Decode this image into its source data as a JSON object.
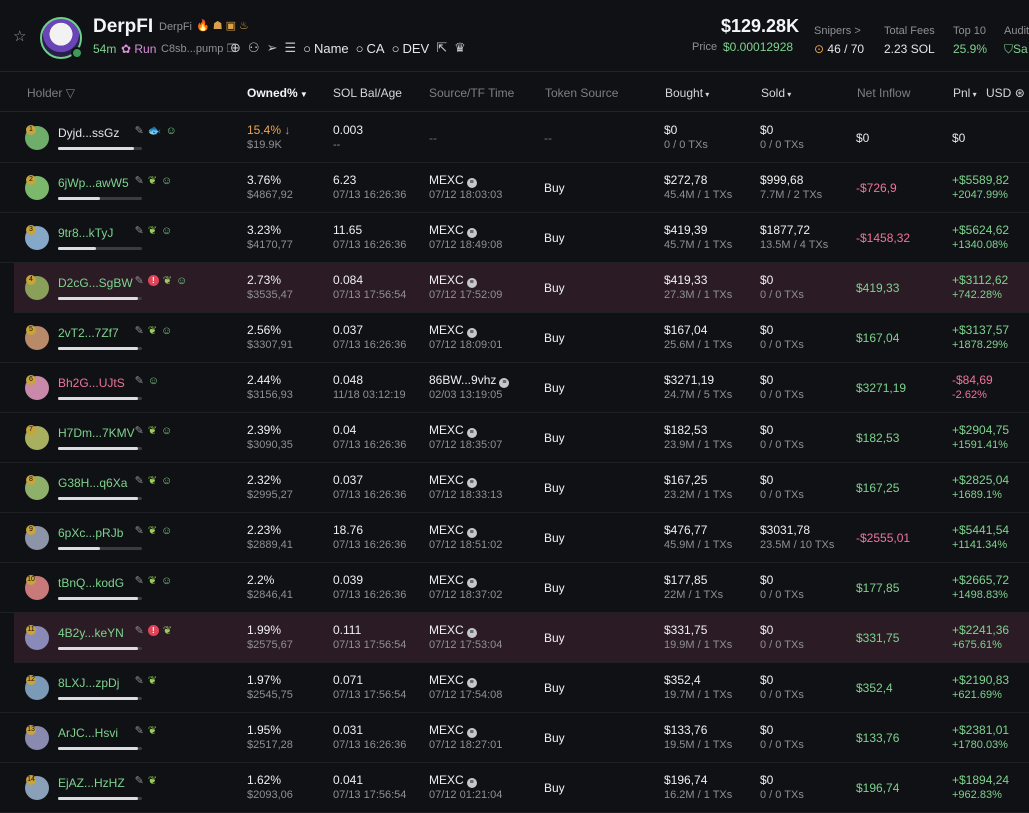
{
  "token": {
    "name": "DerpFI",
    "symbol": "DerpFi",
    "age": "54m",
    "run_label": "Run",
    "contract": "C8sb...pump",
    "tools": {
      "name_label": "Name",
      "ca_label": "CA",
      "dev_label": "DEV"
    }
  },
  "market": {
    "market_cap": "$129.28K",
    "price_label": "Price",
    "price": "$0.00012928"
  },
  "stats": [
    {
      "label": "Snipers >",
      "value": "46 / 70"
    },
    {
      "label": "Total Fees",
      "value": "2.23 SOL"
    },
    {
      "label": "Top 10",
      "value": "25.9%"
    },
    {
      "label": "Audit",
      "value": "Sa"
    }
  ],
  "columns": {
    "holder": "Holder",
    "owned": "Owned%",
    "sol_bal": "SOL Bal/Age",
    "source": "Source/TF Time",
    "token_source": "Token Source",
    "bought": "Bought",
    "sold": "Sold",
    "net_inflow": "Net Inflow",
    "pnl": "Pnl",
    "currency": "USD"
  },
  "rows": [
    {
      "rank": "1",
      "holder": "Dyjd...ssGz",
      "pct": "15.4%",
      "pct_arrow": "↓",
      "value": "$19.9K",
      "sol": "0.003",
      "age": "--",
      "src": "--",
      "tf": "",
      "tsrc": "--",
      "b1": "$0",
      "b2": "0 / 0 TXs",
      "s1": "$0",
      "s2": "0 / 0 TXs",
      "net": "$0",
      "p1": "$0",
      "p2": "",
      "bar": 0.9,
      "icons": "fish"
    },
    {
      "rank": "2",
      "holder": "6jWp...awW5",
      "pct": "3.76%",
      "value": "$4867,92",
      "sol": "6.23",
      "age": "07/13 16:26:36",
      "src": "MEXC",
      "tf": "07/12 18:03:03",
      "tsrc": "Buy",
      "b1": "$272,78",
      "b2": "45.4M / 1 TXs",
      "s1": "$999,68",
      "s2": "7.7M / 2 TXs",
      "net": "-$726,9",
      "p1": "+$5589,82",
      "p2": "+2047.99%",
      "bar": 0.5,
      "icons": "leaf"
    },
    {
      "rank": "3",
      "holder": "9tr8...kTyJ",
      "pct": "3.23%",
      "value": "$4170,77",
      "sol": "11.65",
      "age": "07/13 16:26:36",
      "src": "MEXC",
      "tf": "07/12 18:49:08",
      "tsrc": "Buy",
      "b1": "$419,39",
      "b2": "45.7M / 1 TXs",
      "s1": "$1877,72",
      "s2": "13.5M / 4 TXs",
      "net": "-$1458,32",
      "p1": "+$5624,62",
      "p2": "+1340.08%",
      "bar": 0.45,
      "icons": "leaf"
    },
    {
      "rank": "4",
      "holder": "D2cG...SgBW",
      "pct": "2.73%",
      "value": "$3535,47",
      "sol": "0.084",
      "age": "07/13 17:56:54",
      "src": "MEXC",
      "tf": "07/12 17:52:09",
      "tsrc": "Buy",
      "b1": "$419,33",
      "b2": "27.3M / 1 TXs",
      "s1": "$0",
      "s2": "0 / 0 TXs",
      "net": "$419,33",
      "p1": "+$3112,62",
      "p2": "+742.28%",
      "bar": 0.95,
      "icons": "warn",
      "hl": true
    },
    {
      "rank": "5",
      "holder": "2vT2...7Zf7",
      "pct": "2.56%",
      "value": "$3307,91",
      "sol": "0.037",
      "age": "07/13 16:26:36",
      "src": "MEXC",
      "tf": "07/12 18:09:01",
      "tsrc": "Buy",
      "b1": "$167,04",
      "b2": "25.6M / 1 TXs",
      "s1": "$0",
      "s2": "0 / 0 TXs",
      "net": "$167,04",
      "p1": "+$3137,57",
      "p2": "+1878.29%",
      "bar": 0.95,
      "icons": "leaf"
    },
    {
      "rank": "6",
      "holder": "Bh2G...UJtS",
      "pct": "2.44%",
      "value": "$3156,93",
      "sol": "0.048",
      "age": "11/18 03:12:19",
      "src": "86BW...9vhz",
      "tf": "02/03 13:19:05",
      "tsrc": "Buy",
      "b1": "$3271,19",
      "b2": "24.7M / 5 TXs",
      "s1": "$0",
      "s2": "0 / 0 TXs",
      "net": "$3271,19",
      "p1": "-$84,69",
      "p2": "-2.62%",
      "bar": 0.95,
      "icons": "person",
      "pink": true
    },
    {
      "rank": "7",
      "holder": "H7Dm...7KMV",
      "pct": "2.39%",
      "value": "$3090,35",
      "sol": "0.04",
      "age": "07/13 16:26:36",
      "src": "MEXC",
      "tf": "07/12 18:35:07",
      "tsrc": "Buy",
      "b1": "$182,53",
      "b2": "23.9M / 1 TXs",
      "s1": "$0",
      "s2": "0 / 0 TXs",
      "net": "$182,53",
      "p1": "+$2904,75",
      "p2": "+1591.41%",
      "bar": 0.95,
      "icons": "leaf"
    },
    {
      "rank": "8",
      "holder": "G38H...q6Xa",
      "pct": "2.32%",
      "value": "$2995,27",
      "sol": "0.037",
      "age": "07/13 16:26:36",
      "src": "MEXC",
      "tf": "07/12 18:33:13",
      "tsrc": "Buy",
      "b1": "$167,25",
      "b2": "23.2M / 1 TXs",
      "s1": "$0",
      "s2": "0 / 0 TXs",
      "net": "$167,25",
      "p1": "+$2825,04",
      "p2": "+1689.1%",
      "bar": 0.95,
      "icons": "leaf"
    },
    {
      "rank": "9",
      "holder": "6pXc...pRJb",
      "pct": "2.23%",
      "value": "$2889,41",
      "sol": "18.76",
      "age": "07/13 16:26:36",
      "src": "MEXC",
      "tf": "07/12 18:51:02",
      "tsrc": "Buy",
      "b1": "$476,77",
      "b2": "45.9M / 1 TXs",
      "s1": "$3031,78",
      "s2": "23.5M / 10 TXs",
      "net": "-$2555,01",
      "p1": "+$5441,54",
      "p2": "+1141.34%",
      "bar": 0.5,
      "icons": "leaf"
    },
    {
      "rank": "10",
      "holder": "tBnQ...kodG",
      "pct": "2.2%",
      "value": "$2846,41",
      "sol": "0.039",
      "age": "07/13 16:26:36",
      "src": "MEXC",
      "tf": "07/12 18:37:02",
      "tsrc": "Buy",
      "b1": "$177,85",
      "b2": "22M / 1 TXs",
      "s1": "$0",
      "s2": "0 / 0 TXs",
      "net": "$177,85",
      "p1": "+$2665,72",
      "p2": "+1498.83%",
      "bar": 0.95,
      "icons": "leaf"
    },
    {
      "rank": "11",
      "holder": "4B2y...keYN",
      "pct": "1.99%",
      "value": "$2575,67",
      "sol": "0.111",
      "age": "07/13 17:56:54",
      "src": "MEXC",
      "tf": "07/12 17:53:04",
      "tsrc": "Buy",
      "b1": "$331,75",
      "b2": "19.9M / 1 TXs",
      "s1": "$0",
      "s2": "0 / 0 TXs",
      "net": "$331,75",
      "p1": "+$2241,36",
      "p2": "+675.61%",
      "bar": 0.95,
      "icons": "warnleaf",
      "hl": true
    },
    {
      "rank": "12",
      "holder": "8LXJ...zpDj",
      "pct": "1.97%",
      "value": "$2545,75",
      "sol": "0.071",
      "age": "07/13 17:56:54",
      "src": "MEXC",
      "tf": "07/12 17:54:08",
      "tsrc": "Buy",
      "b1": "$352,4",
      "b2": "19.7M / 1 TXs",
      "s1": "$0",
      "s2": "0 / 0 TXs",
      "net": "$352,4",
      "p1": "+$2190,83",
      "p2": "+621.69%",
      "bar": 0.95,
      "icons": "leafonly"
    },
    {
      "rank": "13",
      "holder": "ArJC...Hsvi",
      "pct": "1.95%",
      "value": "$2517,28",
      "sol": "0.031",
      "age": "07/13 16:26:36",
      "src": "MEXC",
      "tf": "07/12 18:27:01",
      "tsrc": "Buy",
      "b1": "$133,76",
      "b2": "19.5M / 1 TXs",
      "s1": "$0",
      "s2": "0 / 0 TXs",
      "net": "$133,76",
      "p1": "+$2381,01",
      "p2": "+1780.03%",
      "bar": 0.95,
      "icons": "leafonly"
    },
    {
      "rank": "14",
      "holder": "EjAZ...HzHZ",
      "pct": "1.62%",
      "value": "$2093,06",
      "sol": "0.041",
      "age": "07/13 17:56:54",
      "src": "MEXC",
      "tf": "07/12 01:21:04",
      "tsrc": "Buy",
      "b1": "$196,74",
      "b2": "16.2M / 1 TXs",
      "s1": "$0",
      "s2": "0 / 0 TXs",
      "net": "$196,74",
      "p1": "+$1894,24",
      "p2": "+962.83%",
      "bar": 0.95,
      "icons": "leafonly"
    }
  ],
  "colors": {
    "green": "#7ed38f",
    "red": "#f0739a",
    "highlight_row": "#2b1b24",
    "background": "#101114"
  }
}
